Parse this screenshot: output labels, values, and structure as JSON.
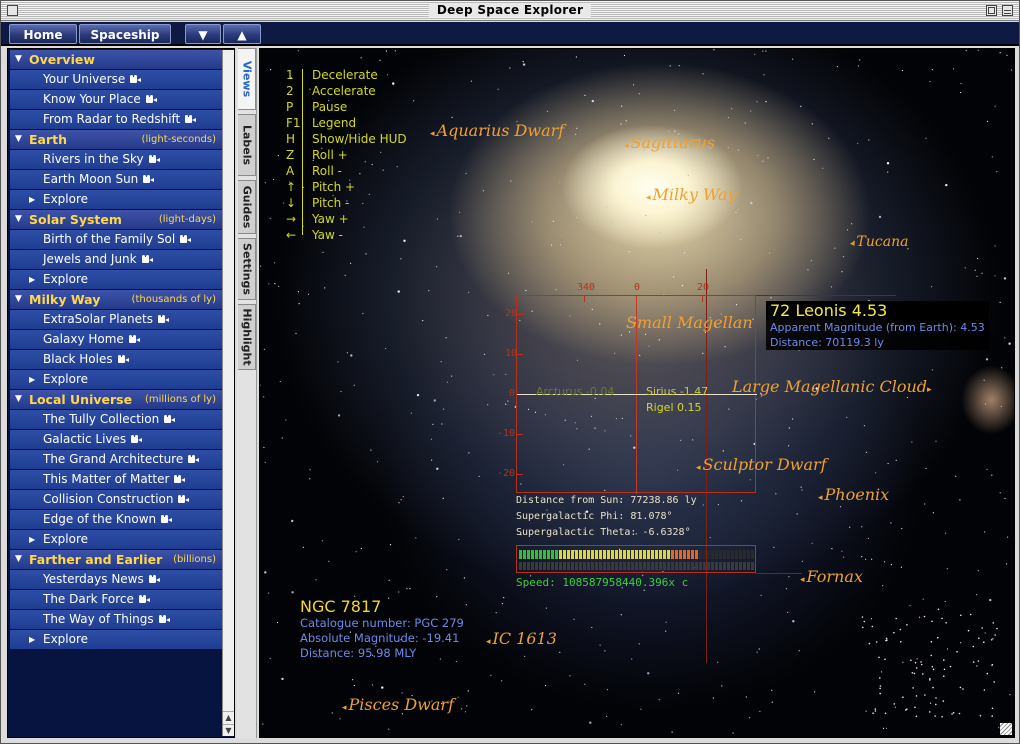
{
  "window": {
    "title": "Deep Space Explorer"
  },
  "nav": {
    "home": "Home",
    "spaceship": "Spaceship",
    "down": "▼",
    "up": "▲"
  },
  "sidebar": {
    "sections": [
      {
        "label": "Overview",
        "unit": "",
        "items": [
          "Your Universe",
          "Know Your Place",
          "From Radar to Redshift"
        ],
        "explore": false
      },
      {
        "label": "Earth",
        "unit": "(light-seconds)",
        "items": [
          "Rivers in the Sky",
          "Earth Moon Sun"
        ],
        "explore": true
      },
      {
        "label": "Solar System",
        "unit": "(light-days)",
        "items": [
          "Birth of the Family Sol",
          "Jewels and Junk"
        ],
        "explore": true
      },
      {
        "label": "Milky Way",
        "unit": "(thousands of ly)",
        "items": [
          "ExtraSolar Planets",
          "Galaxy Home",
          "Black Holes"
        ],
        "explore": true
      },
      {
        "label": "Local Universe",
        "unit": "(millions of ly)",
        "items": [
          "The Tully Collection",
          "Galactic Lives",
          "The Grand Architecture",
          "This Matter of Matter",
          "Collision Construction",
          "Edge of the Known"
        ],
        "explore": true
      },
      {
        "label": "Farther and Earlier",
        "unit": "(billions)",
        "items": [
          "Yesterdays News",
          "The Dark Force",
          "The Way of Things"
        ],
        "explore": true
      }
    ],
    "explore_label": "Explore"
  },
  "tabs": [
    "Views",
    "Labels",
    "Guides",
    "Settings",
    "Highlight"
  ],
  "active_tab": "Views",
  "keys": [
    {
      "key": "1",
      "desc": "Decelerate"
    },
    {
      "key": "2",
      "desc": "Accelerate"
    },
    {
      "key": "P",
      "desc": "Pause"
    },
    {
      "key": "F1",
      "desc": "Legend"
    },
    {
      "key": "H",
      "desc": "Show/Hide HUD"
    },
    {
      "key": "Z",
      "desc": "Roll +"
    },
    {
      "key": "A",
      "desc": "Roll -"
    },
    {
      "key": "↑",
      "desc": "Pitch +"
    },
    {
      "key": "↓",
      "desc": "Pitch -"
    },
    {
      "key": "→",
      "desc": "Yaw +"
    },
    {
      "key": "←",
      "desc": "Yaw -"
    }
  ],
  "labels": {
    "aquarius": "Aquarius Dwarf",
    "sagittarius": "Sagittarus",
    "milkyway": "Milky Way",
    "tucana": "Tucana",
    "small_magellan": "Small Magellan",
    "large_magellan": "Large Magellanic Cloud",
    "sculptor": "Sculptor Dwarf",
    "phoenix": "Phoenix",
    "fornax": "Fornax",
    "ic1613": "IC 1613",
    "pisces": "Pisces Dwarf"
  },
  "ticks": {
    "h340": "340",
    "h0": "0",
    "h20": "20",
    "v20": "20",
    "v10": "10",
    "v0": "0",
    "vm10": "-10",
    "vm20": "-20"
  },
  "stars_inline": {
    "arcturus": "Arcturus -0.04",
    "sirius": "Sirius -1.47",
    "rigel": "Rigel 0.15"
  },
  "star_info": {
    "name": "72 Leonis 4.53",
    "magnitude": "Apparent Magnitude (from Earth): 4.53",
    "distance": "Distance: 70119.3 ly"
  },
  "nav_info": {
    "distance": "Distance from Sun: 77238.86 ly",
    "phi": "Supergalactic Phi: 81.078°",
    "theta": "Supergalactic Theta: -6.6328°"
  },
  "speed": {
    "text": "Speed: 108587958440.396x c",
    "level": 0.76
  },
  "ngc": {
    "name": "NGC 7817",
    "catalogue": "Catalogue number: PGC 279",
    "magnitude": "Absolute Magnitude: -19.41",
    "distance": "Distance: 95.98 MLY"
  },
  "colors": {
    "hud_yellow": "#d4d820",
    "label_orange": "#f0a030",
    "info_blue": "#6b8ce8",
    "grid_red": "#b8301c",
    "speed_green": "#3ad03a"
  }
}
